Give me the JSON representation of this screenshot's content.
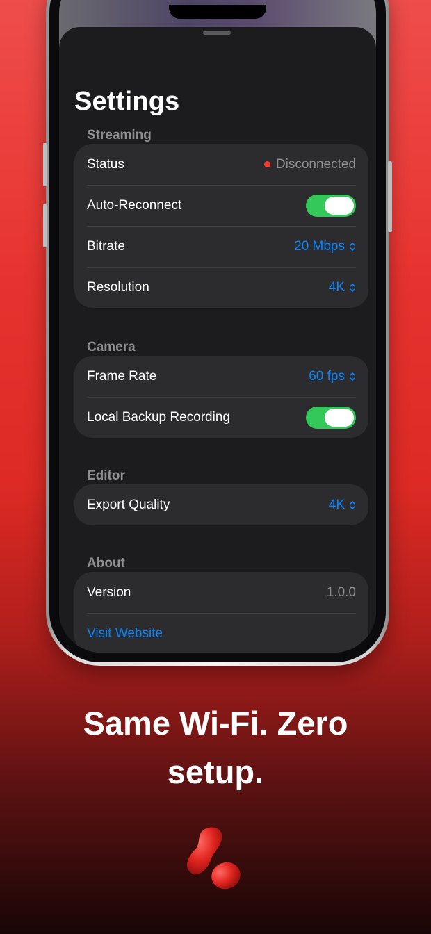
{
  "settings": {
    "title": "Settings",
    "sections": {
      "streaming": {
        "header": "Streaming",
        "status_label": "Status",
        "status_value": "Disconnected",
        "auto_reconnect_label": "Auto-Reconnect",
        "auto_reconnect_on": true,
        "bitrate_label": "Bitrate",
        "bitrate_value": "20 Mbps",
        "resolution_label": "Resolution",
        "resolution_value": "4K"
      },
      "camera": {
        "header": "Camera",
        "frame_rate_label": "Frame Rate",
        "frame_rate_value": "60 fps",
        "local_backup_label": "Local Backup Recording",
        "local_backup_on": true
      },
      "editor": {
        "header": "Editor",
        "export_quality_label": "Export Quality",
        "export_quality_value": "4K"
      },
      "about": {
        "header": "About",
        "version_label": "Version",
        "version_value": "1.0.0",
        "website_link": "Visit Website"
      }
    }
  },
  "marketing": {
    "tagline_line1": "Same Wi-Fi. Zero",
    "tagline_line2": "setup."
  },
  "colors": {
    "accent_blue": "#0a84ff",
    "toggle_green": "#34c759",
    "status_red": "#ff3b30",
    "brand_red": "#e0241f"
  },
  "icons": {
    "status_dot": "red-status-dot-icon",
    "chevron": "chevron-up-down-icon",
    "logo": "app-logo-icon"
  }
}
